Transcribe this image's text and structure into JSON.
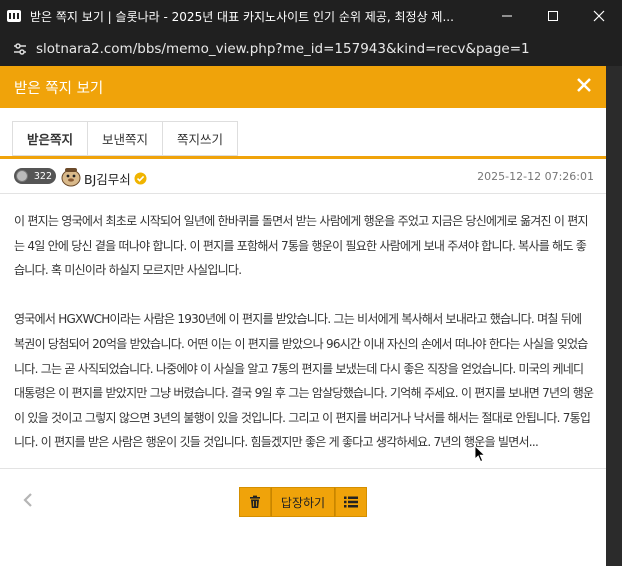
{
  "window": {
    "title": "받은 쪽지 보기 | 슬롯나라 - 2025년 대표 카지노사이트 인기 순위 제공, 최정상 제..."
  },
  "browser": {
    "url": "slotnara2.com/bbs/memo_view.php?me_id=157943&kind=recv&page=1"
  },
  "modal": {
    "title": "받은 쪽지 보기",
    "tabs": [
      {
        "label": "받은쪽지",
        "active": true
      },
      {
        "label": "보낸쪽지",
        "active": false
      },
      {
        "label": "쪽지쓰기",
        "active": false
      }
    ]
  },
  "sender": {
    "level": "322",
    "name": "BJ김무쇠",
    "date": "2025-12-12 07:26:01"
  },
  "message": {
    "paragraph1": "이 편지는 영국에서 최초로 시작되어 일년에 한바퀴를 돌면서 받는 사람에게 행운을 주었고 지금은 당신에게로 옮겨진 이 편지는 4일 안에 당신 곁을 떠나야 합니다. 이 편지를 포함해서 7통을 행운이 필요한 사람에게 보내 주셔야 합니다. 복사를 해도 좋습니다. 혹 미신이라 하실지 모르지만 사실입니다.",
    "paragraph2": "영국에서 HGXWCH이라는 사람은 1930년에 이 편지를 받았습니다. 그는 비서에게 복사해서 보내라고 했습니다. 며칠 뒤에 복권이 당첨되어 20억을 받았습니다. 어떤 이는 이 편지를 받았으나 96시간 이내 자신의 손에서 떠나야 한다는 사실을 잊었습니다. 그는 곧 사직되었습니다. 나중에야 이 사실을 알고 7통의 편지를 보냈는데 다시 좋은 직장을 얻었습니다. 미국의 케네디 대통령은 이 편지를 받았지만 그냥 버렸습니다. 결국 9일 후 그는 암살당했습니다. 기억해 주세요. 이 편지를 보내면 7년의 행운이 있을 것이고 그렇지 않으면 3년의 불행이 있을 것입니다. 그리고 이 편지를 버리거나 낙서를 해서는 절대로 안됩니다. 7통입니다. 이 편지를 받은 사람은 행운이 깃들 것입니다. 힘들겠지만 좋은 게 좋다고 생각하세요. 7년의 행운을 빌면서..."
  },
  "footer": {
    "reply_label": "답장하기"
  },
  "colors": {
    "accent": "#f0a30a",
    "chrome": "#202020"
  },
  "icons": {
    "app": "app-icon",
    "minimize": "minimize-icon",
    "maximize": "maximize-icon",
    "close": "close-icon",
    "site_info": "site-info-icon",
    "modal_close": "close-icon",
    "prev": "chevron-left-icon",
    "trash": "trash-icon",
    "list": "list-icon",
    "verified": "verified-badge-icon"
  }
}
